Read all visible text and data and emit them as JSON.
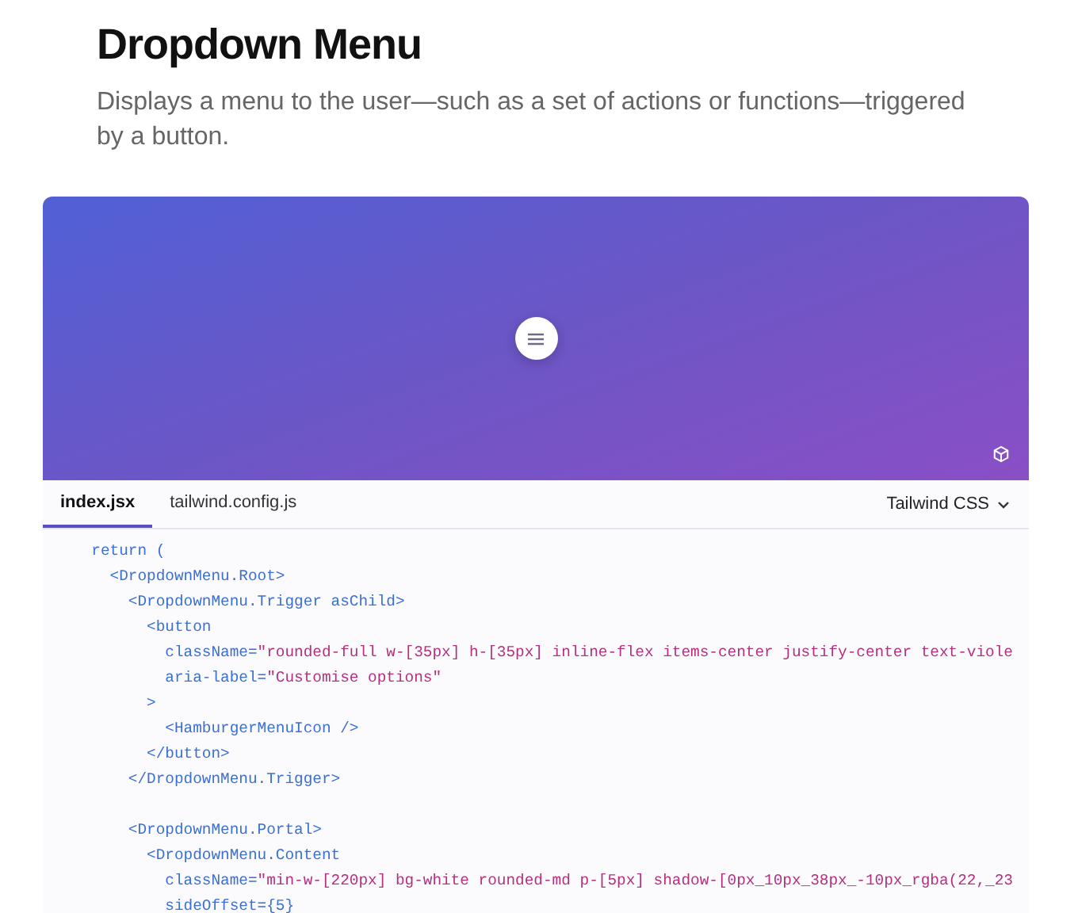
{
  "title": "Dropdown Menu",
  "description": "Displays a menu to the user—such as a set of actions or functions—triggered by a button.",
  "tabs": [
    {
      "label": "index.jsx",
      "selected": true
    },
    {
      "label": "tailwind.config.js",
      "selected": false
    }
  ],
  "language_select": {
    "value": "Tailwind CSS"
  },
  "code_blocks": [
    [
      [
        {
          "kind": "code",
          "text": "  return ("
        }
      ],
      [
        {
          "kind": "code",
          "text": "    <DropdownMenu.Root>"
        }
      ],
      [
        {
          "kind": "code",
          "text": "      <DropdownMenu.Trigger asChild>"
        }
      ],
      [
        {
          "kind": "code",
          "text": "        <button"
        }
      ],
      [
        {
          "kind": "code",
          "text": "          className="
        },
        {
          "kind": "string",
          "text": "\"rounded-full w-[35px] h-[35px] inline-flex items-center justify-center text-viole"
        }
      ],
      [
        {
          "kind": "code",
          "text": "          aria-label="
        },
        {
          "kind": "string",
          "text": "\"Customise options\""
        }
      ],
      [
        {
          "kind": "code",
          "text": "        >"
        }
      ],
      [
        {
          "kind": "code",
          "text": "          <HamburgerMenuIcon />"
        }
      ],
      [
        {
          "kind": "code",
          "text": "        </button>"
        }
      ],
      [
        {
          "kind": "code",
          "text": "      </DropdownMenu.Trigger>"
        }
      ]
    ],
    [
      [
        {
          "kind": "code",
          "text": "      <DropdownMenu.Portal>"
        }
      ],
      [
        {
          "kind": "code",
          "text": "        <DropdownMenu.Content"
        }
      ],
      [
        {
          "kind": "code",
          "text": "          className="
        },
        {
          "kind": "string",
          "text": "\"min-w-[220px] bg-white rounded-md p-[5px] shadow-[0px_10px_38px_-10px_rgba(22,_23"
        }
      ],
      [
        {
          "kind": "code",
          "text": "          sideOffset={5}"
        }
      ]
    ]
  ]
}
